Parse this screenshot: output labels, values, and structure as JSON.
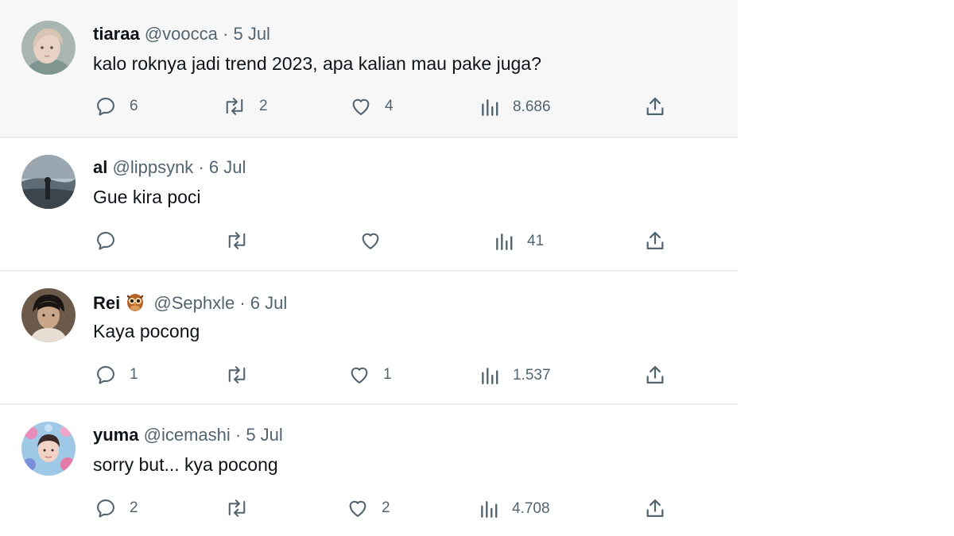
{
  "tweets": [
    {
      "name": "tiaraa",
      "handle": "@voocca",
      "date": "5 Jul",
      "text": "kalo roknya jadi trend 2023, apa kalian mau pake juga?",
      "replies": "6",
      "reposts": "2",
      "likes": "4",
      "views": "8.686"
    },
    {
      "name": "al",
      "handle": "@lippsynk",
      "date": "6 Jul",
      "text": "Gue kira poci",
      "replies": "",
      "reposts": "",
      "likes": "",
      "views": "41"
    },
    {
      "name": "Rei",
      "name_emoji": "owl-emoji",
      "handle": "@Sephxle",
      "date": "6 Jul",
      "text": "Kaya pocong",
      "replies": "1",
      "reposts": "",
      "likes": "1",
      "views": "1.537"
    },
    {
      "name": "yuma",
      "handle": "@icemashi",
      "date": "5 Jul",
      "text": "sorry but... kya pocong",
      "replies": "2",
      "reposts": "",
      "likes": "2",
      "views": "4.708"
    }
  ],
  "separator": "·",
  "icons": {
    "reply": "reply-icon",
    "repost": "repost-icon",
    "like": "like-icon",
    "views": "views-icon",
    "share": "share-icon"
  },
  "colors": {
    "text_primary": "#0f1419",
    "text_secondary": "#536471",
    "highlight_background": "#f7f7f7"
  }
}
